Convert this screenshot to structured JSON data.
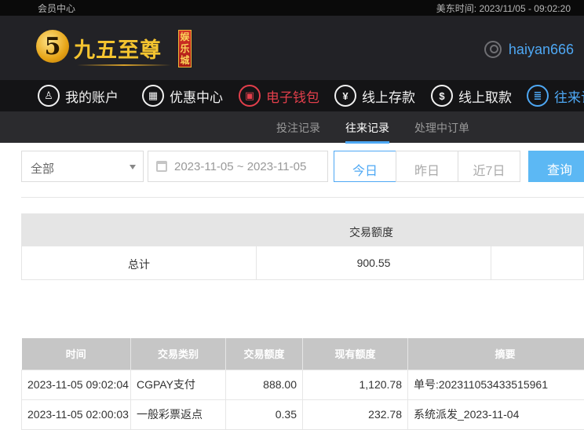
{
  "topbar": {
    "member_center": "会员中心",
    "time_label": "美东时间: 2023/11/05 - 09:02:20"
  },
  "header": {
    "logo_digit": "5",
    "logo_text": "九五至尊",
    "logo_sub": "娱乐城",
    "username": "haiyan666"
  },
  "nav": {
    "items": [
      {
        "label": "我的账户",
        "icon": "user-icon"
      },
      {
        "label": "优惠中心",
        "icon": "gift-icon"
      },
      {
        "label": "电子钱包",
        "icon": "wallet-icon"
      },
      {
        "label": "线上存款",
        "icon": "deposit-icon"
      },
      {
        "label": "线上取款",
        "icon": "withdraw-icon"
      },
      {
        "label": "往来记",
        "icon": "records-icon"
      }
    ]
  },
  "subnav": {
    "tabs": [
      "投注记录",
      "往来记录",
      "处理中订单"
    ]
  },
  "filters": {
    "type_select": "全部",
    "date_range": "2023-11-05 ~ 2023-11-05",
    "today": "今日",
    "yesterday": "昨日",
    "last7": "近7日",
    "query": "查询"
  },
  "summary": {
    "header": "交易额度",
    "total_label": "总计",
    "total_value": "900.55"
  },
  "table": {
    "headers": [
      "时间",
      "交易类别",
      "交易额度",
      "现有额度",
      "摘要"
    ],
    "rows": [
      [
        "2023-11-05 09:02:04",
        "CGPAY支付",
        "888.00",
        "1,120.78",
        "单号:202311053433515961"
      ],
      [
        "2023-11-05 02:00:03",
        "一般彩票返点",
        "0.35",
        "232.78",
        "系统派发_2023-11-04"
      ]
    ]
  },
  "colors": {
    "accent_blue": "#4ea8f4",
    "active_red": "#e33f4b",
    "gold": "#f4c430"
  }
}
